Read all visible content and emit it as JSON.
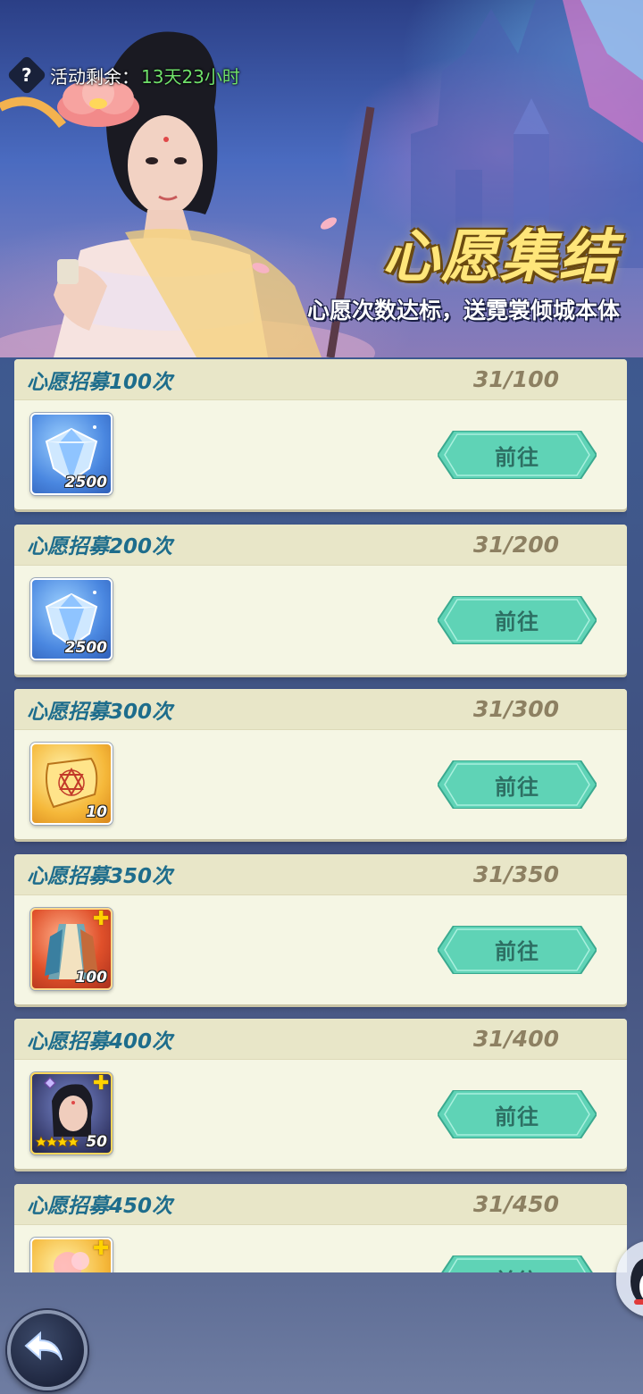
{
  "event": {
    "timer_label": "活动剩余：",
    "timer_value": "13天23小时",
    "title": "心愿集结",
    "subtitle": "心愿次数达标，送霓裳倾城本体",
    "help_icon": "question-icon"
  },
  "tasks": [
    {
      "title": "心愿招募100次",
      "progress": "31/100",
      "reward_icon": "diamond-icon",
      "reward_count": "2500",
      "button": "前往"
    },
    {
      "title": "心愿招募200次",
      "progress": "31/200",
      "reward_icon": "diamond-icon",
      "reward_count": "2500",
      "button": "前往"
    },
    {
      "title": "心愿招募300次",
      "progress": "31/300",
      "reward_icon": "scroll-icon",
      "reward_count": "10",
      "button": "前往"
    },
    {
      "title": "心愿招募350次",
      "progress": "31/350",
      "reward_icon": "costume-shard-icon",
      "reward_count": "100",
      "button": "前往"
    },
    {
      "title": "心愿招募400次",
      "progress": "31/400",
      "reward_icon": "hero-shard-icon",
      "reward_count": "50",
      "button": "前往"
    },
    {
      "title": "心愿招募450次",
      "progress": "31/450",
      "reward_icon": "gold-shard-icon",
      "reward_count": "",
      "button": "前往"
    }
  ],
  "colors": {
    "title_text": "#1e6d8c",
    "progress_text": "#8d8062",
    "button_fill": "#5fd3b6",
    "timer_value": "#6fe06a",
    "headline": "#ffe67a"
  },
  "nav": {
    "back_icon": "back-arrow-icon",
    "float_icon": "penguin-icon"
  }
}
